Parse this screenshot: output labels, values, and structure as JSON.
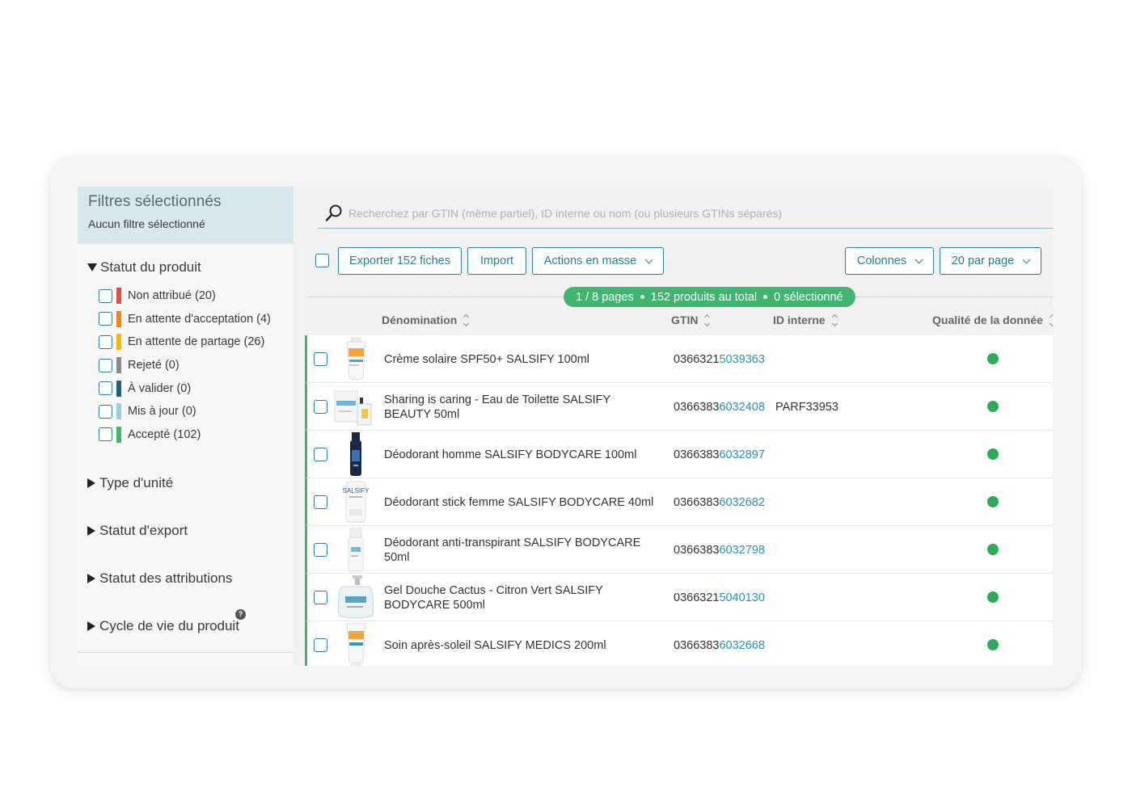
{
  "sidebar": {
    "filters_title": "Filtres sélectionnés",
    "filters_subtitle": "Aucun filtre sélectionné",
    "product_status": {
      "title": "Statut du produit",
      "items": [
        {
          "label": "Non attribué (20)",
          "color": "#e74c3c"
        },
        {
          "label": "En attente d'acceptation (4)",
          "color": "#f0851f"
        },
        {
          "label": "En attente de partage (26)",
          "color": "#f5b800"
        },
        {
          "label": "Rejeté (0)",
          "color": "#8a8a8a"
        },
        {
          "label": "À valider (0)",
          "color": "#1d5f82"
        },
        {
          "label": "Mis à jour (0)",
          "color": "#9acfe0"
        },
        {
          "label": "Accepté (102)",
          "color": "#3fb56e"
        }
      ]
    },
    "sections": [
      "Type d'unité",
      "Statut d'export",
      "Statut des attributions",
      "Cycle de vie du produit"
    ]
  },
  "search": {
    "placeholder": "Recherchez par GTIN (même partiel), ID interne ou nom (ou plusieurs GTINs séparés)"
  },
  "toolbar": {
    "export_label": "Exporter 152 fiches",
    "import_label": "Import",
    "mass_actions_label": "Actions en masse",
    "columns_label": "Colonnes",
    "per_page_label": "20 par page"
  },
  "pager": {
    "pages": "1 / 8 pages",
    "total": "152 produits au total",
    "selected": "0 sélectionné"
  },
  "table": {
    "headers": {
      "name": "Dénomination",
      "gtin": "GTIN",
      "internal_id": "ID interne",
      "quality": "Qualité de la donnée"
    },
    "rows": [
      {
        "name": "Crème solaire SPF50+ SALSIFY 100ml",
        "gtin_prefix": "0366321",
        "gtin_suffix": "5039363",
        "internal_id": "",
        "thumb": "tube-orange"
      },
      {
        "name": "Sharing is caring - Eau de Toilette SALSIFY BEAUTY 50ml",
        "gtin_prefix": "0366383",
        "gtin_suffix": "6032408",
        "internal_id": "PARF33953",
        "thumb": "perfume-box"
      },
      {
        "name": "Déodorant homme SALSIFY BODYCARE 100ml",
        "gtin_prefix": "0366383",
        "gtin_suffix": "6032897",
        "internal_id": "",
        "thumb": "spray-navy"
      },
      {
        "name": "Déodorant stick femme SALSIFY BODYCARE 40ml",
        "gtin_prefix": "0366383",
        "gtin_suffix": "6032682",
        "internal_id": "",
        "thumb": "stick-white"
      },
      {
        "name": "Déodorant anti-transpirant SALSIFY BODYCARE 50ml",
        "gtin_prefix": "0366383",
        "gtin_suffix": "6032798",
        "internal_id": "",
        "thumb": "rollon-white"
      },
      {
        "name": "Gel Douche Cactus - Citron Vert SALSIFY BODYCARE 500ml",
        "gtin_prefix": "0366321",
        "gtin_suffix": "5040130",
        "internal_id": "",
        "thumb": "pump-bottle"
      },
      {
        "name": "Soin après-soleil SALSIFY MEDICS 200ml",
        "gtin_prefix": "0366383",
        "gtin_suffix": "6032668",
        "internal_id": "",
        "thumb": "tube-blue"
      }
    ]
  },
  "colors": {
    "accent": "#2a7c97",
    "gtin_highlight": "#2a92ad",
    "success": "#3fb56e",
    "quality_dot": "#2eaa5d"
  }
}
